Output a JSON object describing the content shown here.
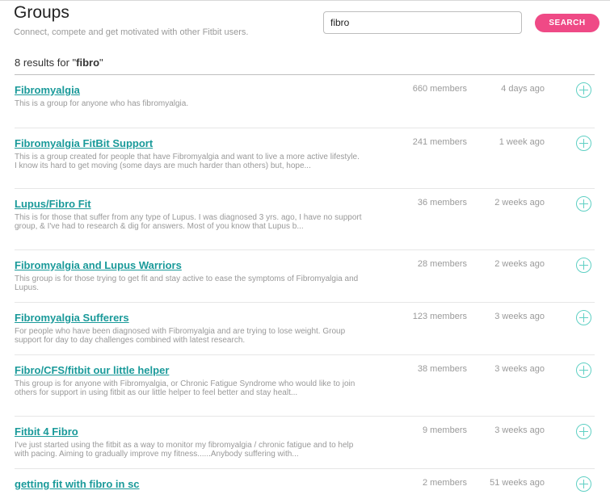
{
  "header": {
    "title": "Groups",
    "subtitle": "Connect, compete and get motivated with other Fitbit users."
  },
  "search": {
    "value": "fibro",
    "button_label": "SEARCH"
  },
  "results": {
    "prefix": "8 results for \"",
    "query": "fibro",
    "suffix": "\""
  },
  "groups": [
    {
      "name": "Fibromyalgia",
      "description": "This is a group for anyone who has fibromyalgia.",
      "members": "660 members",
      "activity": "4 days ago"
    },
    {
      "name": "Fibromyalgia FitBit Support",
      "description": "This is a group created for people that have Fibromyalgia and want to live a more active lifestyle. I know its hard to get moving (some days are much harder than others) but, hope...",
      "members": "241 members",
      "activity": "1 week ago"
    },
    {
      "name": "Lupus/Fibro Fit",
      "description": "This is for those that suffer from any type of Lupus. I was diagnosed 3 yrs. ago, I have no support group, & I've had to research & dig for answers. Most of you know that Lupus b...",
      "members": "36 members",
      "activity": "2 weeks ago"
    },
    {
      "name": "Fibromyalgia and Lupus Warriors",
      "description": "This group is for those trying to get fit and stay active to ease the symptoms of Fibromyalgia and Lupus.",
      "members": "28 members",
      "activity": "2 weeks ago"
    },
    {
      "name": "Fibromyalgia Sufferers",
      "description": "For people who have been diagnosed with Fibromyalgia and are trying to lose weight. Group support for day to day challenges combined with latest research.",
      "members": "123 members",
      "activity": "3 weeks ago"
    },
    {
      "name": "Fibro/CFS/fitbit our little helper",
      "description": "This group is for anyone with Fibromyalgia, or Chronic Fatigue Syndrome who would like to join others for support in using fitbit as our little helper to feel better and stay healt...",
      "members": "38 members",
      "activity": "3 weeks ago"
    },
    {
      "name": "Fitbit 4 Fibro",
      "description": "I've just started using the fitbit as a way to monitor my fibromyalgia / chronic fatigue and to help with pacing. Aiming to gradually improve my fitness......Anybody suffering with...",
      "members": "9 members",
      "activity": "3 weeks ago"
    },
    {
      "name": "getting fit with fibro in sc",
      "description": "",
      "members": "2 members",
      "activity": "51 weeks ago"
    }
  ],
  "icons": {
    "join": "plus-circle-icon"
  },
  "colors": {
    "accent": "#ef4a86",
    "link": "#1a9a9a",
    "join_icon": "#5fd0c4"
  }
}
